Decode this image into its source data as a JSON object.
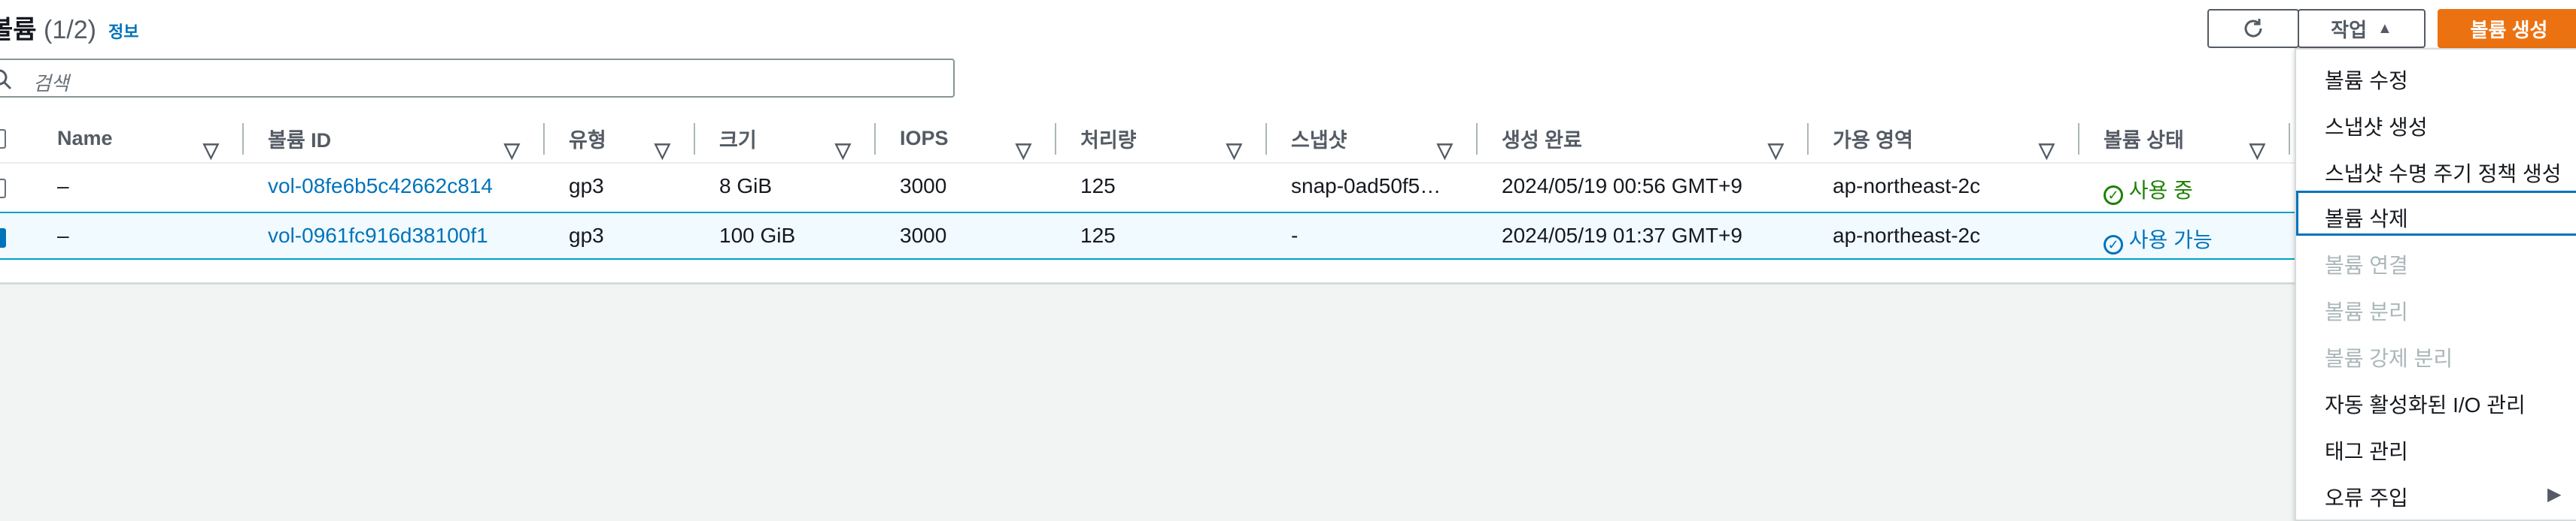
{
  "header": {
    "title": "볼륨",
    "count": "(1/2)",
    "info_link": "정보"
  },
  "toolbar": {
    "refresh_icon": "refresh-icon",
    "actions_label": "작업",
    "create_label": "볼륨 생성"
  },
  "search": {
    "placeholder": "검색"
  },
  "table": {
    "columns": [
      "Name",
      "볼륨 ID",
      "유형",
      "크기",
      "IOPS",
      "처리량",
      "스냅샷",
      "생성 완료",
      "가용 영역",
      "볼륨 상태"
    ],
    "rows": [
      {
        "name": "–",
        "volume_id": "vol-08fe6b5c42662c814",
        "type": "gp3",
        "size": "8 GiB",
        "iops": "3000",
        "throughput": "125",
        "snapshot": "snap-0ad50f5…",
        "created": "2024/05/19 00:56 GMT+9",
        "az": "ap-northeast-2c",
        "status": "사용 중",
        "selected": false
      },
      {
        "name": "–",
        "volume_id": "vol-0961fc916d38100f1",
        "type": "gp3",
        "size": "100 GiB",
        "iops": "3000",
        "throughput": "125",
        "snapshot": "-",
        "created": "2024/05/19 01:37 GMT+9",
        "az": "ap-northeast-2c",
        "status": "사용 가능",
        "selected": true
      }
    ]
  },
  "actions_menu": {
    "items": [
      {
        "label": "볼륨 수정",
        "disabled": false
      },
      {
        "label": "스냅샷 생성",
        "disabled": false
      },
      {
        "label": "스냅샷 수명 주기 정책 생성",
        "disabled": false
      },
      {
        "label": "볼륨 삭제",
        "disabled": false,
        "focused": true
      },
      {
        "label": "볼륨 연결",
        "disabled": true
      },
      {
        "label": "볼륨 분리",
        "disabled": true
      },
      {
        "label": "볼륨 강제 분리",
        "disabled": true
      },
      {
        "label": "자동 활성화된 I/O 관리",
        "disabled": false
      },
      {
        "label": "태그 관리",
        "disabled": false
      },
      {
        "label": "오류 주입",
        "disabled": false,
        "submenu": true
      }
    ]
  },
  "colors": {
    "accent": "#0073bb",
    "primary_button": "#ec7211",
    "success": "#1d8102"
  }
}
